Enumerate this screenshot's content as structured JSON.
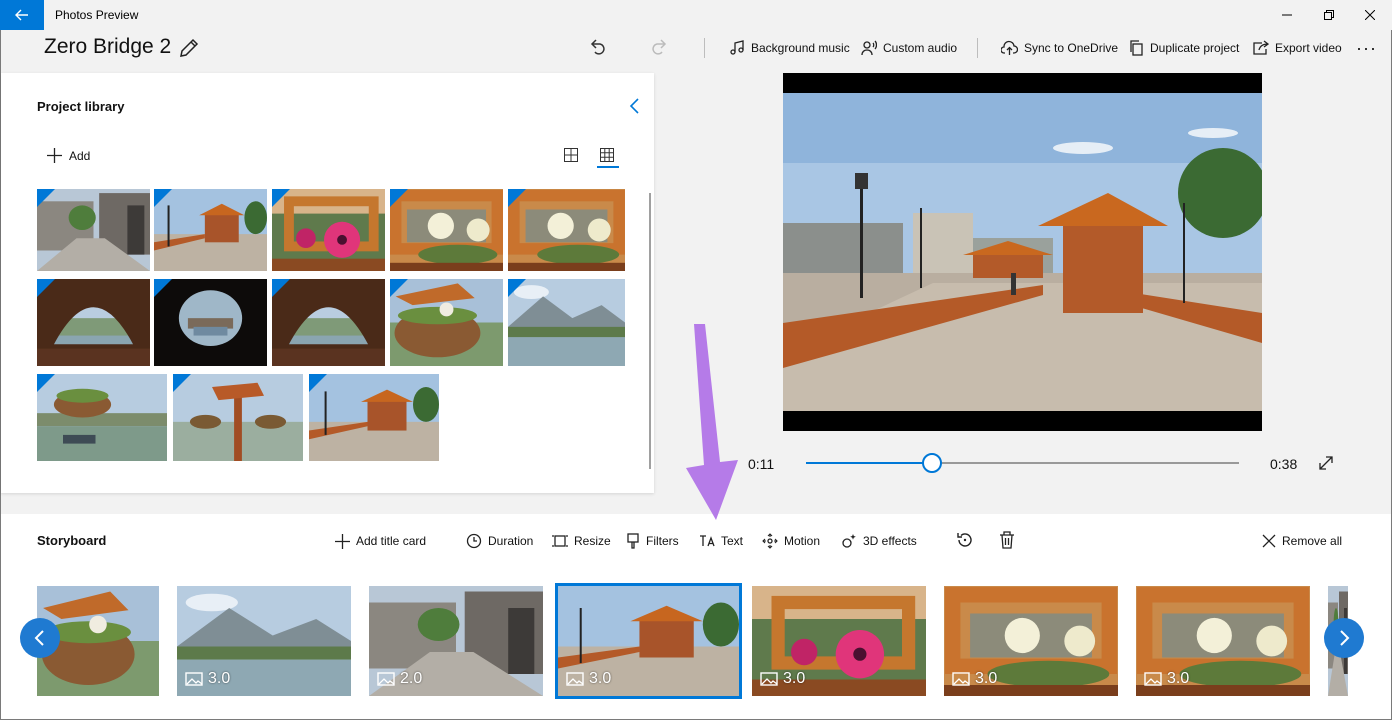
{
  "window": {
    "title": "Photos Preview",
    "controls": [
      "minimize",
      "maximize",
      "close"
    ]
  },
  "header": {
    "project_name": "Zero Bridge 2",
    "actions": {
      "background_music": "Background music",
      "custom_audio": "Custom audio",
      "sync": "Sync to OneDrive",
      "duplicate": "Duplicate project",
      "export": "Export video"
    },
    "more": "···"
  },
  "library": {
    "title": "Project library",
    "add_label": "Add",
    "items": [
      {
        "scene": "street"
      },
      {
        "scene": "bridge"
      },
      {
        "scene": "flower-pink"
      },
      {
        "scene": "flower-white"
      },
      {
        "scene": "flower-white"
      },
      {
        "scene": "lattice"
      },
      {
        "scene": "keyhole"
      },
      {
        "scene": "lattice"
      },
      {
        "scene": "basket"
      },
      {
        "scene": "lake"
      },
      {
        "scene": "basket-lake"
      },
      {
        "scene": "signpost"
      },
      {
        "scene": "bridge"
      }
    ]
  },
  "player": {
    "current_time": "0:11",
    "total_time": "0:38",
    "progress": 0.29
  },
  "storyboard": {
    "title": "Storyboard",
    "tools": {
      "add_title_card": "Add title card",
      "duration": "Duration",
      "resize": "Resize",
      "filters": "Filters",
      "text": "Text",
      "motion": "Motion",
      "effects_3d": "3D effects",
      "remove_all": "Remove all"
    },
    "clips": [
      {
        "scene": "basket",
        "duration": ""
      },
      {
        "scene": "lake",
        "duration": "3.0"
      },
      {
        "scene": "street",
        "duration": "2.0"
      },
      {
        "scene": "bridge",
        "duration": "3.0",
        "selected": true
      },
      {
        "scene": "flower-pink",
        "duration": "3.0"
      },
      {
        "scene": "flower-white",
        "duration": "3.0"
      },
      {
        "scene": "flower-white",
        "duration": "3.0"
      },
      {
        "scene": "street",
        "duration": ""
      }
    ]
  },
  "colors": {
    "accent": "#0078d7",
    "annotation_arrow": "#b57be8"
  }
}
